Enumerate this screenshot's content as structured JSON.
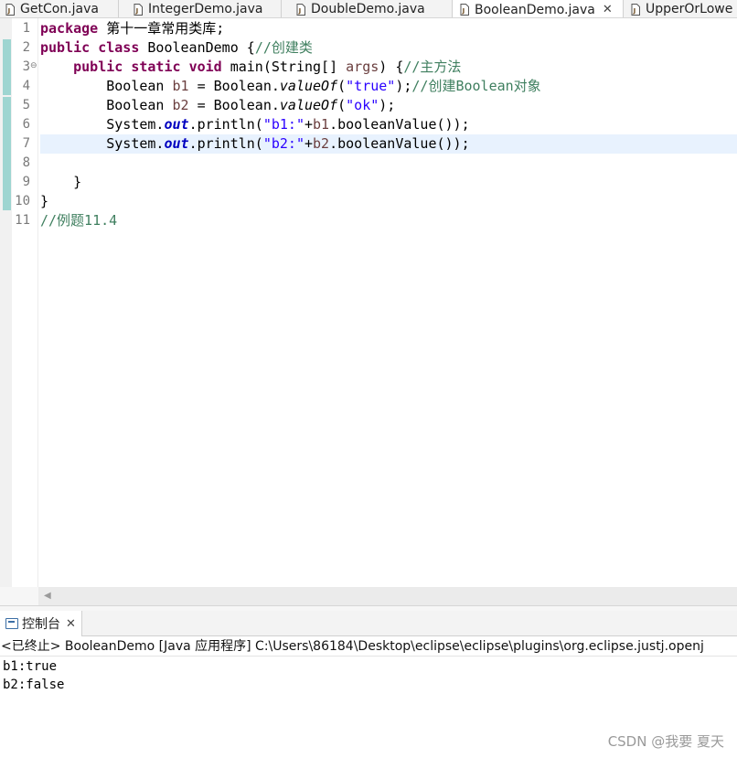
{
  "tabs": [
    {
      "label": "GetCon.java",
      "active": false
    },
    {
      "label": "IntegerDemo.java",
      "active": false
    },
    {
      "label": "DoubleDemo.java",
      "active": false
    },
    {
      "label": "BooleanDemo.java",
      "active": true,
      "close": "✕"
    },
    {
      "label": "UpperOrLowe",
      "active": false
    }
  ],
  "editor": {
    "line_numbers": [
      "1",
      "2",
      "3",
      "4",
      "5",
      "6",
      "7",
      "8",
      "9",
      "10",
      "11"
    ],
    "fold_marker": "⊖",
    "current_line": 7,
    "lines": {
      "l1": {
        "kw": "package",
        "rest": " 第十一章常用类库;"
      },
      "l2": {
        "kw1": "public",
        "kw2": "class",
        "name": " BooleanDemo {",
        "comment": "//创建类"
      },
      "l3": {
        "indent": "    ",
        "kw1": "public",
        "kw2": "static",
        "kw3": "void",
        "sig": " main(String[] ",
        "param": "args",
        "brace": ") {",
        "comment": "//主方法"
      },
      "l4": {
        "lead": "        Boolean ",
        "var": "b1",
        "mid": " = Boolean.",
        "method": "valueOf",
        "open": "(",
        "str": "\"true\"",
        "close": ");",
        "comment": "//创建Boolean对象"
      },
      "l5": {
        "lead": "        Boolean ",
        "var": "b2",
        "mid": " = Boolean.",
        "method": "valueOf",
        "open": "(",
        "str": "\"ok\"",
        "close": ");"
      },
      "l6": {
        "lead": "        System.",
        "field": "out",
        "call": ".println(",
        "str": "\"b1:\"",
        "plus": "+",
        "var": "b1",
        "tail": ".booleanValue());"
      },
      "l7": {
        "lead": "        System.",
        "field": "out",
        "call": ".println(",
        "str": "\"b2:\"",
        "plus": "+",
        "var": "b2",
        "tail": ".booleanValue());"
      },
      "l8": {
        "text": ""
      },
      "l9": {
        "text": "    }"
      },
      "l10": {
        "text": "}"
      },
      "l11": {
        "comment": "//例题11.4"
      }
    },
    "scroll_left_arrow": "◀"
  },
  "console": {
    "tab_label": "控制台",
    "tab_close": "✕",
    "status": "<已终止> BooleanDemo [Java 应用程序] C:\\Users\\86184\\Desktop\\eclipse\\eclipse\\plugins\\org.eclipse.justj.openj",
    "output": [
      "b1:true",
      "b2:false"
    ]
  },
  "watermark": "CSDN @我要 夏天",
  "colors": {
    "keyword": "#7f0055",
    "comment": "#3f7f5f",
    "string": "#2a00ff",
    "field": "#0000c0",
    "current_line": "#e8f2fe",
    "quick_diff": "#9ed5d1"
  }
}
